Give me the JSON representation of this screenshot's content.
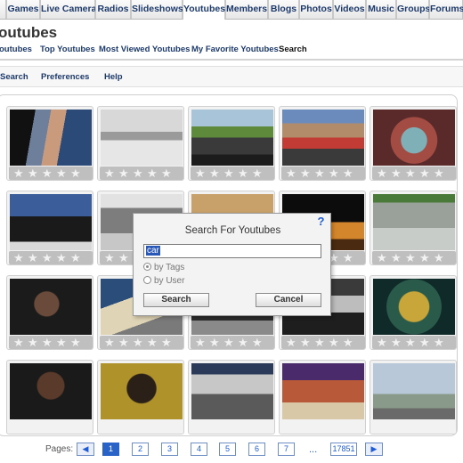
{
  "top_tabs": [
    "Games",
    "Live Camera",
    "Radios",
    "Slideshows",
    "Youtubes",
    "Members",
    "Blogs",
    "Photos",
    "Videos",
    "Music",
    "Groups",
    "Forums"
  ],
  "page_title": "outubes",
  "sub_nav": [
    "outubes",
    "Top Youtubes",
    "Most Viewed Youtubes",
    "My Favorite Youtubes",
    "Search"
  ],
  "toolbar": [
    "Search",
    "Preferences",
    "Help"
  ],
  "star_glyph": "★",
  "dialog": {
    "title": "Search For Youtubes",
    "query": "car",
    "help_icon": "?",
    "option_tags": "by Tags",
    "option_user": "by User",
    "search_button": "Search",
    "cancel_button": "Cancel"
  },
  "pager": {
    "label": "Pages:",
    "prev": "◀",
    "next": "▶",
    "pages": [
      "1",
      "2",
      "3",
      "4",
      "5",
      "6",
      "7"
    ],
    "ellipsis": "...",
    "last": "17851",
    "current": "1"
  }
}
